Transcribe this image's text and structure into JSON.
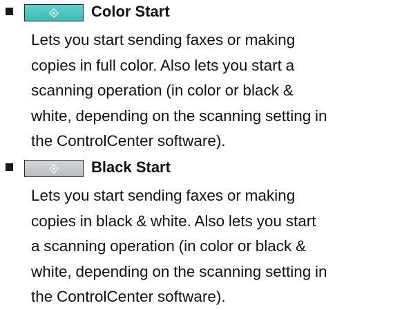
{
  "entries": [
    {
      "title": "Color Start",
      "key_icon": "start-diamond-icon",
      "key_color": "#4cc4be",
      "lines": [
        "Lets you start sending faxes or making",
        "copies in full color. Also lets you start a",
        "scanning operation (in color or black &",
        "white, depending on the scanning setting in",
        "the ControlCenter software)."
      ]
    },
    {
      "title": "Black Start",
      "key_icon": "start-diamond-icon",
      "key_color": "#c6c8cb",
      "lines": [
        "Lets you start sending faxes or making",
        "copies in black & white. Also lets you start",
        "a scanning operation (in color or black &",
        "white, depending on the scanning setting in",
        "the ControlCenter software)."
      ]
    }
  ]
}
